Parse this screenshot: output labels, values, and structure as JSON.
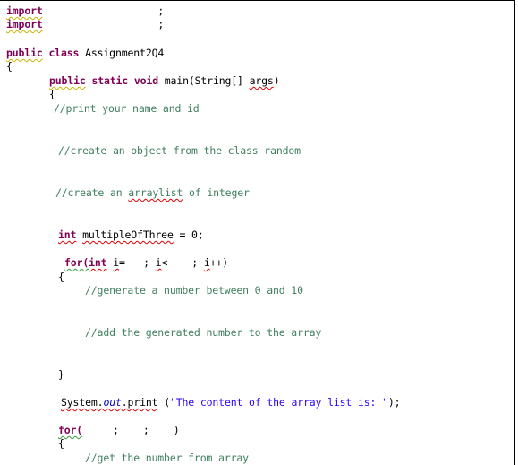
{
  "editor": {
    "lines": {
      "import1": {
        "kw": "import",
        "rest": "                   ;"
      },
      "import2": {
        "kw": "import",
        "rest": "                   ;"
      },
      "class_decl": {
        "kw1": "public",
        "kw2": "class",
        "name": " Assignment2Q4"
      },
      "class_open": "{",
      "main_decl": {
        "kw1": "public",
        "kw2": "static",
        "kw3": "void",
        "sig": " main(String[] ",
        "param": "args",
        "close": ")"
      },
      "main_open": "{",
      "comment_print": "//print your name and id",
      "comment_random": "//create an object from the class random",
      "comment_arraylist_a": "//create an ",
      "comment_arraylist_b": "arraylist",
      "comment_arraylist_c": " of integer",
      "var_decl": {
        "kw": "int",
        "name": "multipleOfThree",
        "rest": " = 0;"
      },
      "for1": {
        "kw1": "for(",
        "kw2": "int",
        "v1": "i",
        "p1": "=   ; ",
        "v2": "i",
        "p2": "<    ; ",
        "v3": "i",
        "p3": "++)"
      },
      "for1_open": "{",
      "comment_generate": "//generate a number between 0 and 10",
      "comment_add": "//add the generated number to the array",
      "for1_close": "}",
      "print_stmt": {
        "obj": "System",
        "dot1": ".",
        "field": "out",
        "dot2": ".",
        "method": "print",
        "open": " (",
        "string": "\"The content of the array list is: \"",
        "close": ");"
      },
      "for2": {
        "kw": "for(",
        "rest": "     ;    ;    )"
      },
      "for2_open": "{",
      "comment_get": "//get the number from array"
    }
  },
  "colors": {
    "keyword": "#7f0055",
    "comment": "#3f7f5f",
    "string": "#2a00ff",
    "field": "#0000c0",
    "error_squiggle": "#e00000",
    "warning_squiggle": "#c8b400"
  }
}
